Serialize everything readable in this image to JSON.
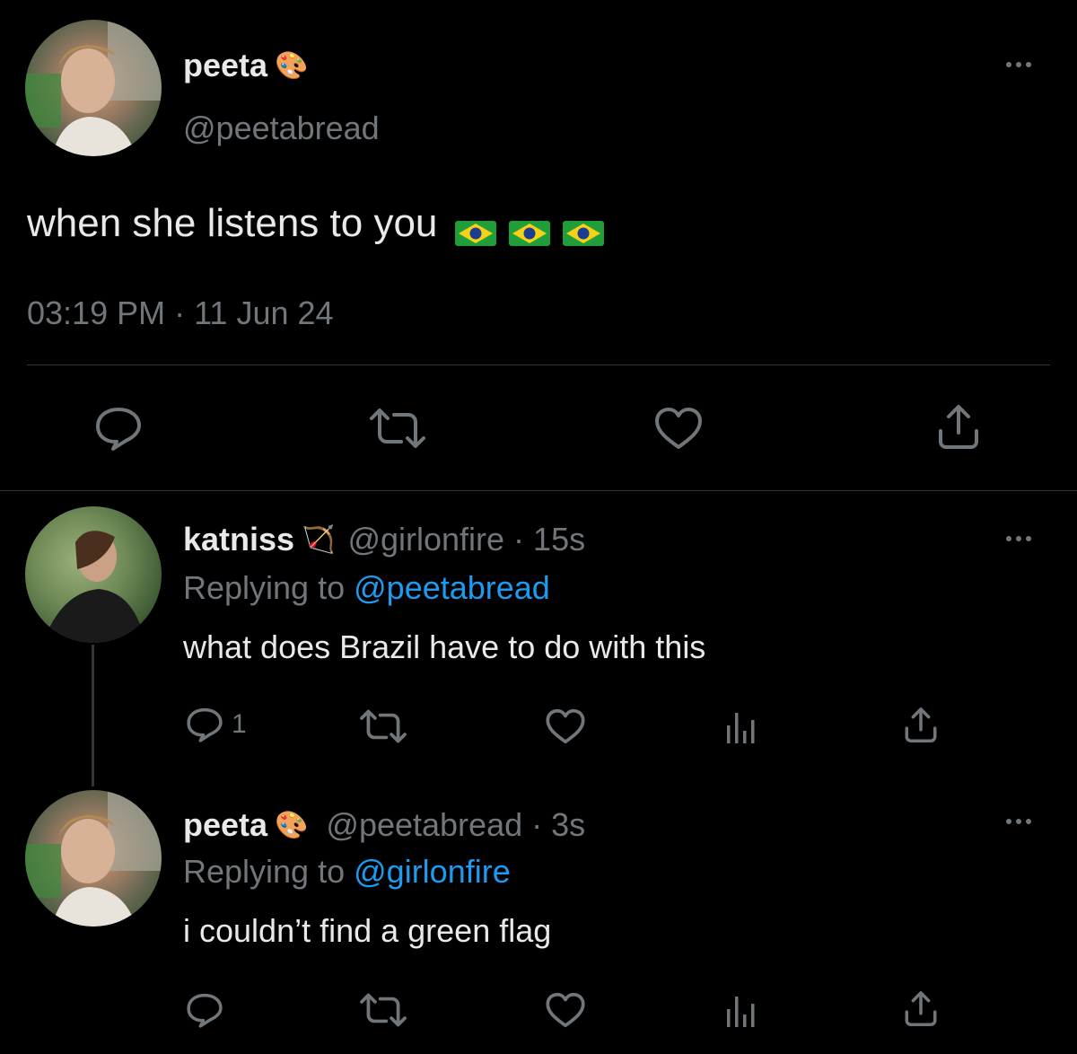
{
  "main_tweet": {
    "display_name": "peeta",
    "name_emoji": "🎨",
    "handle": "@peetabread",
    "text": "when she listens to you",
    "flag_emojis": [
      "flag-brazil-icon",
      "flag-brazil-icon",
      "flag-brazil-icon"
    ],
    "timestamp": "03:19 PM · 11 Jun 24"
  },
  "reply_1": {
    "display_name": "katniss",
    "name_emoji": "🏹",
    "handle": "@girlonfire",
    "age": "15s",
    "replying_label": "Replying to",
    "replying_to": "@peetabread",
    "text": "what does Brazil have to do with this",
    "reply_count": "1"
  },
  "reply_2": {
    "display_name": "peeta",
    "name_emoji": "🎨",
    "handle": "@peetabread",
    "age": "3s",
    "replying_label": "Replying to",
    "replying_to": "@girlonfire",
    "text": "i couldn’t find a green flag"
  },
  "colors": {
    "background": "#000000",
    "text": "#e7e9ea",
    "muted": "#71767b",
    "link": "#1d9bf0",
    "divider": "#2f3336"
  }
}
